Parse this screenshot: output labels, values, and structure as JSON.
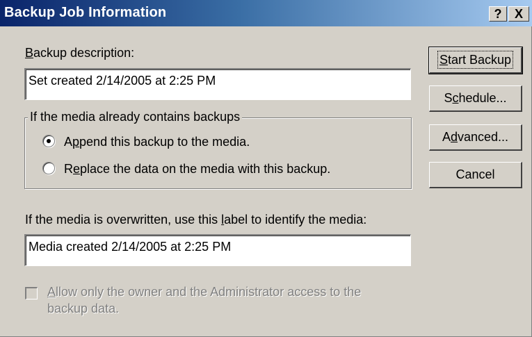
{
  "window": {
    "title": "Backup Job Information",
    "help_label": "?",
    "close_label": "X"
  },
  "description": {
    "label": "Backup description:",
    "value": "Set created 2/14/2005 at 2:25 PM"
  },
  "media_group": {
    "legend": "If the media already contains backups",
    "options": [
      {
        "label": "Append this backup to the media.",
        "selected": true
      },
      {
        "label": "Replace the data on the media with this backup.",
        "selected": false
      }
    ]
  },
  "media_label": {
    "label": "If the media is overwritten, use this label to identify the media:",
    "value": "Media created 2/14/2005 at 2:25 PM"
  },
  "access": {
    "line1": "Allow only the owner and the Administrator access to the",
    "line2": "backup data.",
    "checked": false,
    "enabled": false
  },
  "buttons": {
    "start_backup": "Start Backup",
    "schedule": "Schedule...",
    "advanced": "Advanced...",
    "cancel": "Cancel"
  },
  "colors": {
    "titlebar_start": "#0a246a",
    "titlebar_end": "#a6caf0",
    "face": "#d4d0c8"
  }
}
